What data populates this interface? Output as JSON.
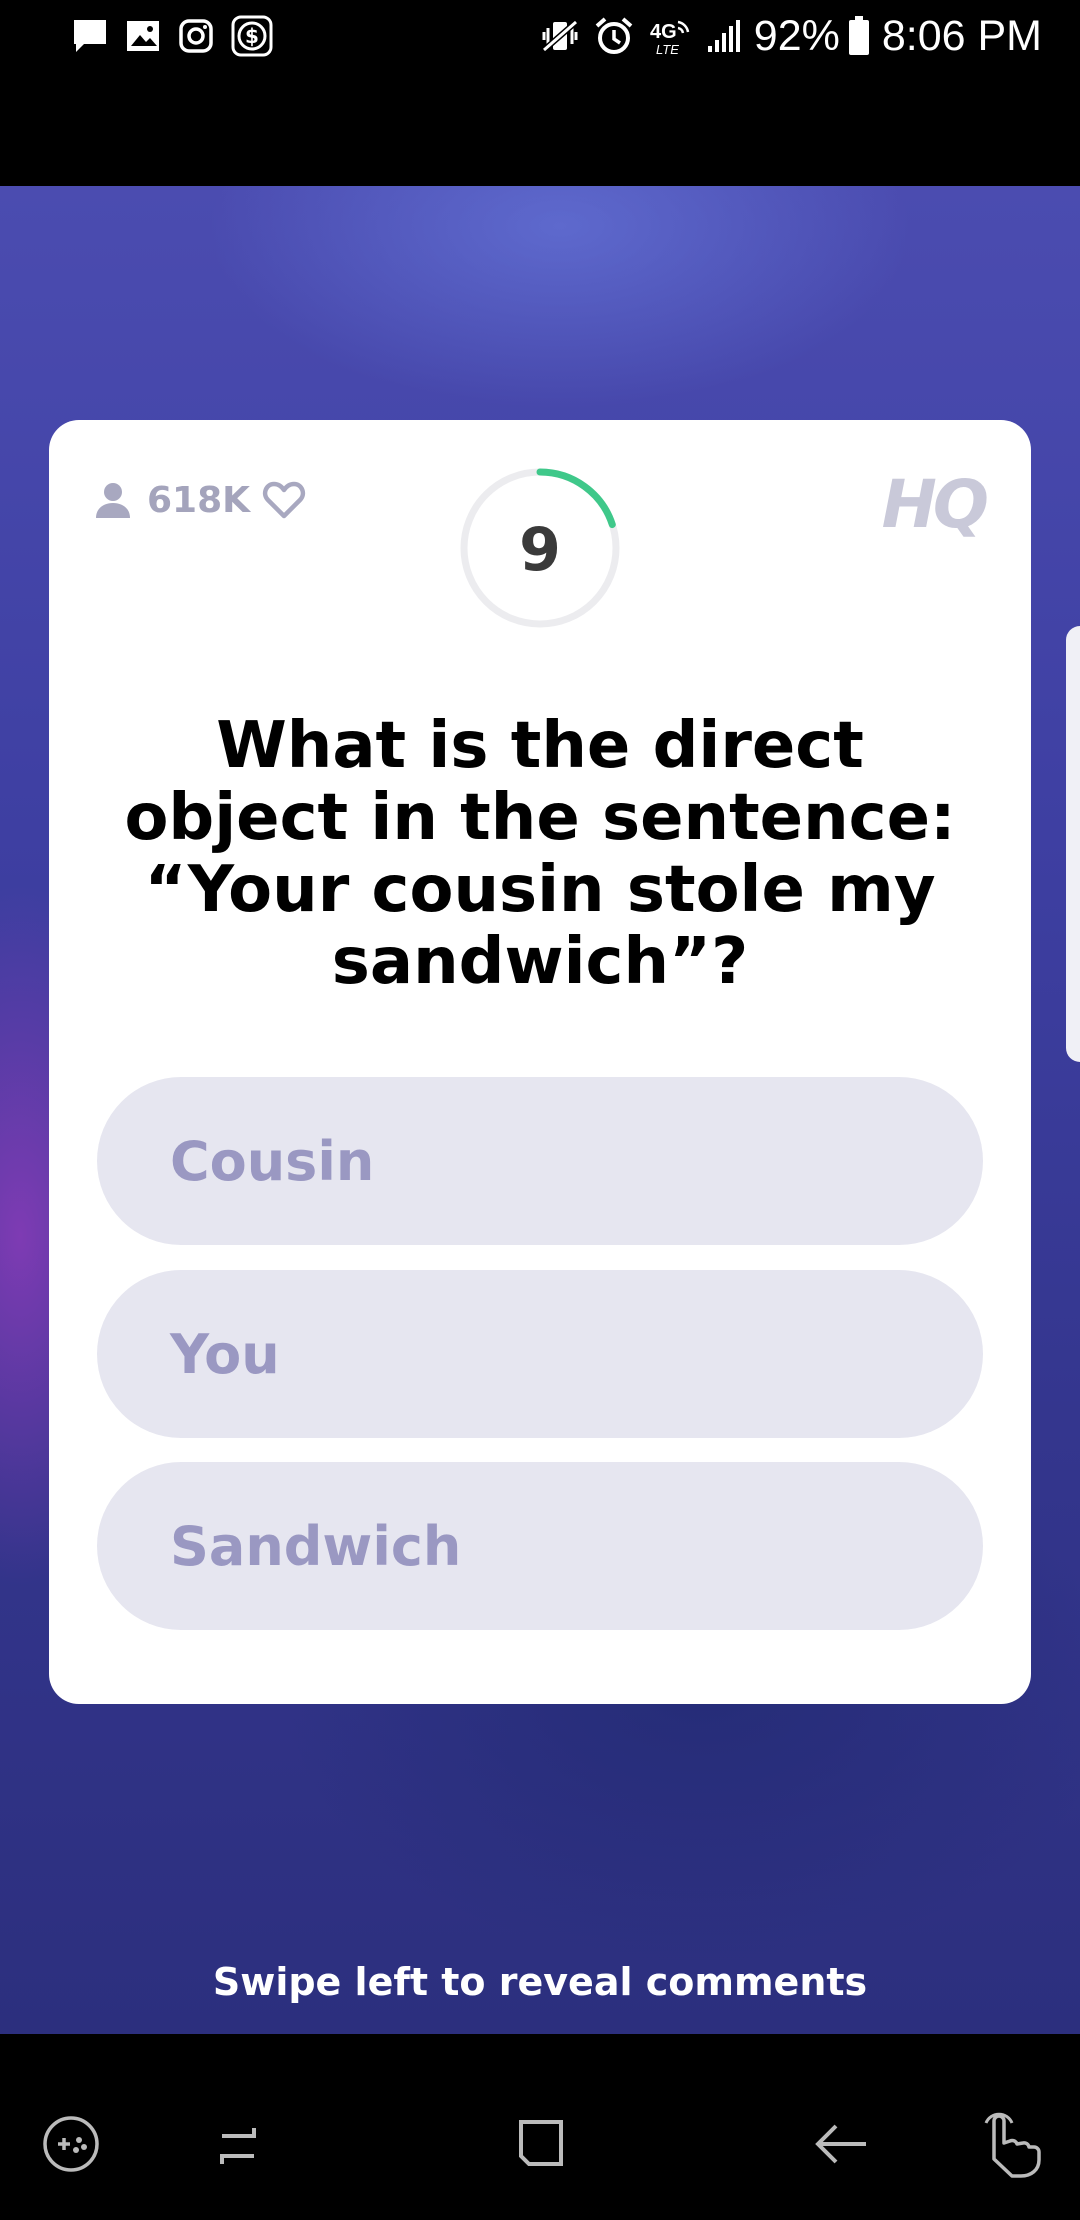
{
  "status_bar": {
    "battery": "92%",
    "time": "8:06 PM",
    "network": "4G LTE",
    "left_icons": [
      "message-icon",
      "gallery-icon",
      "instagram-icon",
      "money-icon"
    ],
    "right_icons": [
      "vibrate-icon",
      "alarm-icon",
      "lte-icon",
      "signal-icon",
      "battery-icon"
    ]
  },
  "card": {
    "viewers": "618K",
    "timer": "9",
    "timer_progress": 0.2,
    "logo": "HQ",
    "question": "What is the direct object in the sentence: “Your cousin stole my sandwich”?",
    "answers": [
      "Cousin",
      "You",
      "Sandwich"
    ]
  },
  "footer": {
    "swipe_hint": "Swipe left to reveal comments"
  },
  "nav_bar": {
    "buttons": [
      "game-tools-icon",
      "recents-icon",
      "home-icon",
      "back-icon",
      "gesture-icon"
    ]
  },
  "colors": {
    "accent_timer": "#3fc88a",
    "answer_bg": "#e6e6f0",
    "answer_text": "#9a98c2",
    "background": "#3e3fa2"
  }
}
